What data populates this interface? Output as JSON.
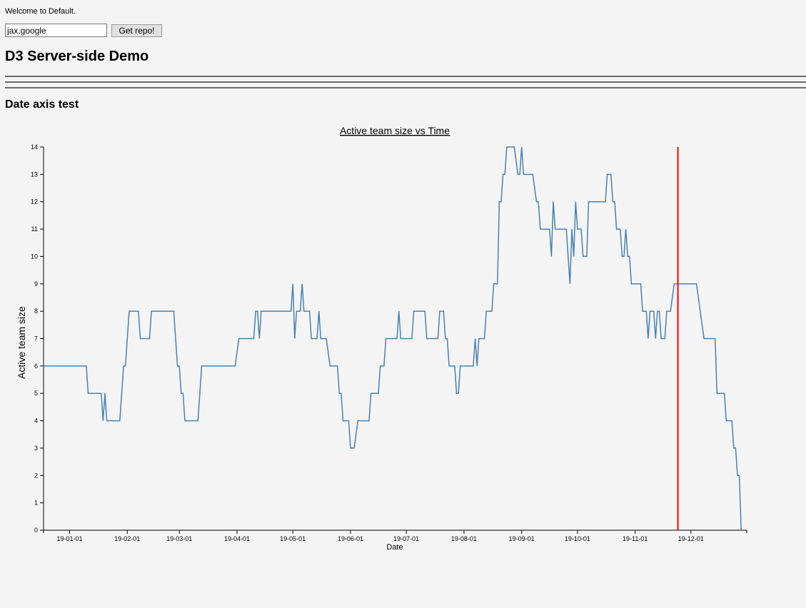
{
  "header": {
    "welcome": "Welcome to Default.",
    "repo_input_value": "jax,google",
    "repo_button_label": "Get repo!",
    "page_title": "D3 Server-side Demo"
  },
  "section": {
    "title": "Date axis test"
  },
  "colors": {
    "line": "#4682b4",
    "marker": "#ff0000",
    "background": "#f4f4f4"
  },
  "chart_data": {
    "type": "line",
    "title": "Active team size vs Time",
    "xlabel": "Date",
    "ylabel": "Active team size",
    "xlim": [
      "2018-12-18",
      "2019-12-31"
    ],
    "ylim": [
      0,
      14
    ],
    "yticks": [
      0,
      1,
      2,
      3,
      4,
      5,
      6,
      7,
      8,
      9,
      10,
      11,
      12,
      13,
      14
    ],
    "xticks": [
      "2019-01-01",
      "2019-02-01",
      "2019-03-01",
      "2019-04-01",
      "2019-05-01",
      "2019-06-01",
      "2019-07-01",
      "2019-08-01",
      "2019-09-01",
      "2019-10-01",
      "2019-11-01",
      "2019-12-01"
    ],
    "xtick_labels": [
      "19-01-01",
      "19-02-01",
      "19-03-01",
      "19-04-01",
      "19-05-01",
      "19-06-01",
      "19-07-01",
      "19-08-01",
      "19-09-01",
      "19-10-01",
      "19-11-01",
      "19-12-01"
    ],
    "grid": false,
    "legend": "none",
    "series": [
      {
        "points": [
          [
            "2018-12-18",
            6
          ],
          [
            "2019-01-10",
            6
          ],
          [
            "2019-01-11",
            5
          ],
          [
            "2019-01-18",
            5
          ],
          [
            "2019-01-19",
            4
          ],
          [
            "2019-01-20",
            5
          ],
          [
            "2019-01-21",
            4
          ],
          [
            "2019-01-28",
            4
          ],
          [
            "2019-01-30",
            6
          ],
          [
            "2019-01-31",
            6
          ],
          [
            "2019-02-02",
            8
          ],
          [
            "2019-02-07",
            8
          ],
          [
            "2019-02-08",
            7
          ],
          [
            "2019-02-13",
            7
          ],
          [
            "2019-02-14",
            8
          ],
          [
            "2019-02-26",
            8
          ],
          [
            "2019-02-28",
            6
          ],
          [
            "2019-03-01",
            6
          ],
          [
            "2019-03-02",
            5
          ],
          [
            "2019-03-03",
            5
          ],
          [
            "2019-03-04",
            4
          ],
          [
            "2019-03-11",
            4
          ],
          [
            "2019-03-13",
            6
          ],
          [
            "2019-03-31",
            6
          ],
          [
            "2019-04-02",
            7
          ],
          [
            "2019-04-10",
            7
          ],
          [
            "2019-04-11",
            8
          ],
          [
            "2019-04-12",
            8
          ],
          [
            "2019-04-13",
            7
          ],
          [
            "2019-04-14",
            8
          ],
          [
            "2019-04-30",
            8
          ],
          [
            "2019-05-01",
            9
          ],
          [
            "2019-05-02",
            7
          ],
          [
            "2019-05-03",
            8
          ],
          [
            "2019-05-05",
            8
          ],
          [
            "2019-05-06",
            9
          ],
          [
            "2019-05-07",
            8
          ],
          [
            "2019-05-10",
            8
          ],
          [
            "2019-05-11",
            7
          ],
          [
            "2019-05-14",
            7
          ],
          [
            "2019-05-15",
            8
          ],
          [
            "2019-05-16",
            7
          ],
          [
            "2019-05-19",
            7
          ],
          [
            "2019-05-21",
            6
          ],
          [
            "2019-05-25",
            6
          ],
          [
            "2019-05-26",
            5
          ],
          [
            "2019-05-27",
            5
          ],
          [
            "2019-05-28",
            4
          ],
          [
            "2019-05-31",
            4
          ],
          [
            "2019-06-01",
            3
          ],
          [
            "2019-06-03",
            3
          ],
          [
            "2019-06-05",
            4
          ],
          [
            "2019-06-11",
            4
          ],
          [
            "2019-06-12",
            5
          ],
          [
            "2019-06-16",
            5
          ],
          [
            "2019-06-17",
            6
          ],
          [
            "2019-06-19",
            6
          ],
          [
            "2019-06-20",
            7
          ],
          [
            "2019-06-26",
            7
          ],
          [
            "2019-06-27",
            8
          ],
          [
            "2019-06-28",
            7
          ],
          [
            "2019-07-04",
            7
          ],
          [
            "2019-07-05",
            8
          ],
          [
            "2019-07-11",
            8
          ],
          [
            "2019-07-12",
            7
          ],
          [
            "2019-07-18",
            7
          ],
          [
            "2019-07-19",
            8
          ],
          [
            "2019-07-21",
            8
          ],
          [
            "2019-07-22",
            7
          ],
          [
            "2019-07-23",
            7
          ],
          [
            "2019-07-24",
            6
          ],
          [
            "2019-07-27",
            6
          ],
          [
            "2019-07-28",
            5
          ],
          [
            "2019-07-29",
            5
          ],
          [
            "2019-07-30",
            6
          ],
          [
            "2019-08-06",
            6
          ],
          [
            "2019-08-07",
            7
          ],
          [
            "2019-08-08",
            6
          ],
          [
            "2019-08-09",
            7
          ],
          [
            "2019-08-12",
            7
          ],
          [
            "2019-08-13",
            8
          ],
          [
            "2019-08-16",
            8
          ],
          [
            "2019-08-17",
            9
          ],
          [
            "2019-08-19",
            9
          ],
          [
            "2019-08-20",
            12
          ],
          [
            "2019-08-21",
            12
          ],
          [
            "2019-08-22",
            13
          ],
          [
            "2019-08-23",
            13
          ],
          [
            "2019-08-24",
            14
          ],
          [
            "2019-08-28",
            14
          ],
          [
            "2019-08-30",
            13
          ],
          [
            "2019-08-31",
            13
          ],
          [
            "2019-09-01",
            14
          ],
          [
            "2019-09-02",
            13
          ],
          [
            "2019-09-07",
            13
          ],
          [
            "2019-09-09",
            12
          ],
          [
            "2019-09-10",
            12
          ],
          [
            "2019-09-11",
            11
          ],
          [
            "2019-09-16",
            11
          ],
          [
            "2019-09-17",
            10
          ],
          [
            "2019-09-18",
            12
          ],
          [
            "2019-09-19",
            11
          ],
          [
            "2019-09-25",
            11
          ],
          [
            "2019-09-26",
            10
          ],
          [
            "2019-09-27",
            9
          ],
          [
            "2019-09-28",
            11
          ],
          [
            "2019-09-29",
            10
          ],
          [
            "2019-09-30",
            12
          ],
          [
            "2019-10-01",
            11
          ],
          [
            "2019-10-03",
            11
          ],
          [
            "2019-10-04",
            10
          ],
          [
            "2019-10-06",
            10
          ],
          [
            "2019-10-07",
            12
          ],
          [
            "2019-10-16",
            12
          ],
          [
            "2019-10-17",
            13
          ],
          [
            "2019-10-19",
            13
          ],
          [
            "2019-10-20",
            12
          ],
          [
            "2019-10-21",
            12
          ],
          [
            "2019-10-22",
            11
          ],
          [
            "2019-10-24",
            11
          ],
          [
            "2019-10-25",
            10
          ],
          [
            "2019-10-26",
            10
          ],
          [
            "2019-10-27",
            11
          ],
          [
            "2019-10-28",
            10
          ],
          [
            "2019-10-29",
            10
          ],
          [
            "2019-10-30",
            9
          ],
          [
            "2019-11-04",
            9
          ],
          [
            "2019-11-05",
            8
          ],
          [
            "2019-11-07",
            8
          ],
          [
            "2019-11-08",
            7
          ],
          [
            "2019-11-09",
            8
          ],
          [
            "2019-11-11",
            8
          ],
          [
            "2019-11-12",
            7
          ],
          [
            "2019-11-13",
            8
          ],
          [
            "2019-11-14",
            8
          ],
          [
            "2019-11-15",
            7
          ],
          [
            "2019-11-17",
            7
          ],
          [
            "2019-11-18",
            8
          ],
          [
            "2019-11-20",
            8
          ],
          [
            "2019-11-22",
            9
          ],
          [
            "2019-12-04",
            9
          ],
          [
            "2019-12-08",
            7
          ],
          [
            "2019-12-14",
            7
          ],
          [
            "2019-12-15",
            5
          ],
          [
            "2019-12-19",
            5
          ],
          [
            "2019-12-20",
            4
          ],
          [
            "2019-12-23",
            4
          ],
          [
            "2019-12-24",
            3
          ],
          [
            "2019-12-25",
            3
          ],
          [
            "2019-12-26",
            2
          ],
          [
            "2019-12-27",
            2
          ],
          [
            "2019-12-28",
            0
          ]
        ]
      }
    ],
    "vertical_marker": {
      "x": "2019-11-24"
    }
  }
}
